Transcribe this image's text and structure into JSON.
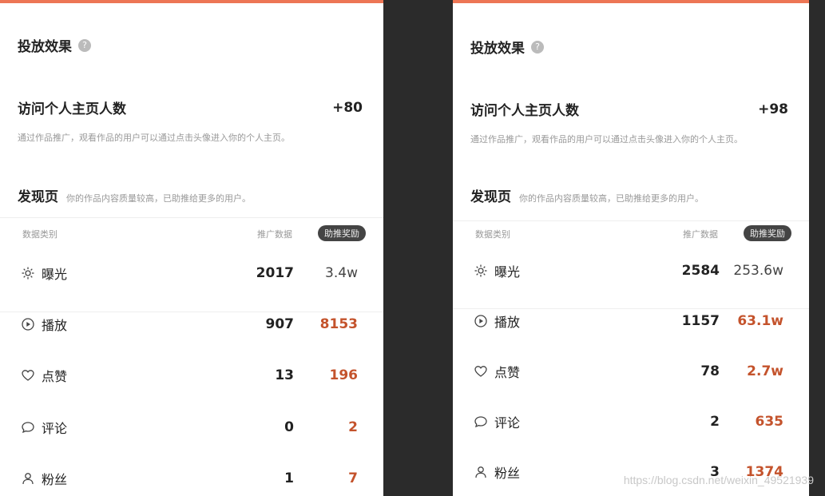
{
  "left": {
    "title": "投放效果",
    "visit_label": "访问个人主页人数",
    "visit_value": "+80",
    "desc": "通过作品推广，观看作品的用户可以通过点击头像进入你的个人主页。",
    "discover_title": "发现页",
    "discover_sub": "你的作品内容质量较高，已助推给更多的用户。",
    "col_category": "数据类别",
    "col_promo": "推广数据",
    "col_boost": "助推奖励",
    "rows": [
      {
        "label": "曝光",
        "promo": "2017",
        "boost": "3.4w",
        "icon": "sun-icon"
      },
      {
        "label": "播放",
        "promo": "907",
        "boost": "8153",
        "icon": "play-icon"
      },
      {
        "label": "点赞",
        "promo": "13",
        "boost": "196",
        "icon": "heart-icon"
      },
      {
        "label": "评论",
        "promo": "0",
        "boost": "2",
        "icon": "comment-icon"
      },
      {
        "label": "粉丝",
        "promo": "1",
        "boost": "7",
        "icon": "user-icon"
      }
    ]
  },
  "right": {
    "title": "投放效果",
    "visit_label": "访问个人主页人数",
    "visit_value": "+98",
    "desc": "通过作品推广，观看作品的用户可以通过点击头像进入你的个人主页。",
    "discover_title": "发现页",
    "discover_sub": "你的作品内容质量较高，已助推给更多的用户。",
    "col_category": "数据类别",
    "col_promo": "推广数据",
    "col_boost": "助推奖励",
    "rows": [
      {
        "label": "曝光",
        "promo": "2584",
        "boost": "253.6w",
        "icon": "sun-icon"
      },
      {
        "label": "播放",
        "promo": "1157",
        "boost": "63.1w",
        "icon": "play-icon"
      },
      {
        "label": "点赞",
        "promo": "78",
        "boost": "2.7w",
        "icon": "heart-icon"
      },
      {
        "label": "评论",
        "promo": "2",
        "boost": "635",
        "icon": "comment-icon"
      },
      {
        "label": "粉丝",
        "promo": "3",
        "boost": "1374",
        "icon": "user-icon"
      }
    ]
  },
  "watermark": "https://blog.csdn.net/weixin_49521939",
  "colors": {
    "accent": "#c4532c",
    "bg": "#2b2b2b"
  }
}
